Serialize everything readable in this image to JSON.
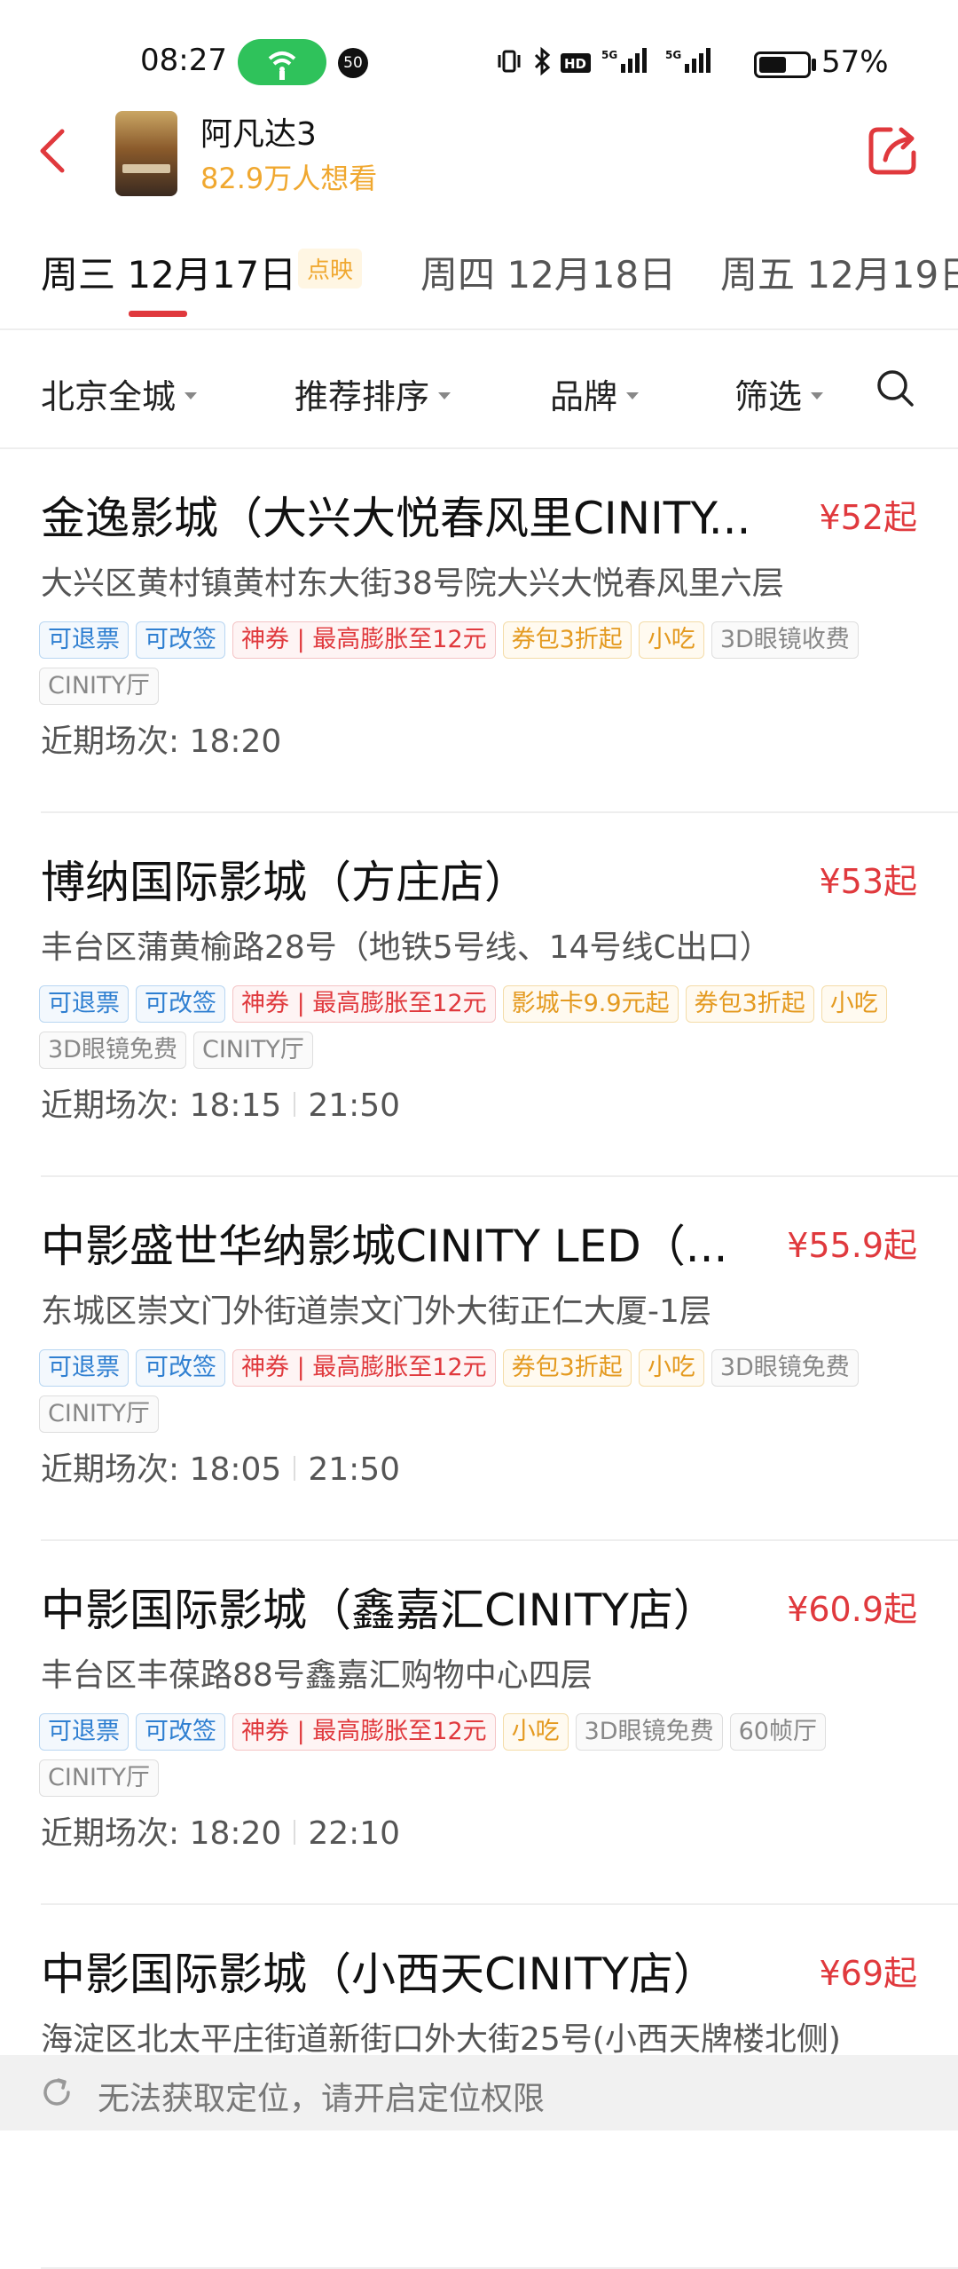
{
  "status_bar": {
    "time": "08:27",
    "notification_count": "50",
    "battery_percent": "57%",
    "battery_level": 0.57
  },
  "header": {
    "movie_title": "阿凡达3",
    "want_to_watch": "82.9万人想看"
  },
  "date_tabs": [
    {
      "label": "周三 12月17日",
      "tag": "点映",
      "active": true
    },
    {
      "label": "周四 12月18日",
      "active": false
    },
    {
      "label": "周五 12月19日",
      "active": false
    }
  ],
  "filters": {
    "city": "北京全城",
    "sort": "推荐排序",
    "brand": "品牌",
    "filter": "筛选"
  },
  "cinemas": [
    {
      "name": "金逸影城（大兴大悦春风里CINITY...",
      "price": "¥52起",
      "address": "大兴区黄村镇黄村东大街38号院大兴大悦春风里六层",
      "tags": [
        {
          "text": "可退票",
          "color": "blue"
        },
        {
          "text": "可改签",
          "color": "blue"
        },
        {
          "text": "神券 | 最高膨胀至12元",
          "color": "red"
        },
        {
          "text": "券包3折起",
          "color": "orange"
        },
        {
          "text": "小吃",
          "color": "orange"
        },
        {
          "text": "3D眼镜收费",
          "color": "gray"
        },
        {
          "text": "CINITY厅",
          "color": "gray"
        }
      ],
      "sessions_label": "近期场次:",
      "sessions": [
        "18:20"
      ]
    },
    {
      "name": "博纳国际影城（方庄店）",
      "price": "¥53起",
      "address": "丰台区蒲黄榆路28号（地铁5号线、14号线C出口）",
      "tags": [
        {
          "text": "可退票",
          "color": "blue"
        },
        {
          "text": "可改签",
          "color": "blue"
        },
        {
          "text": "神券 | 最高膨胀至12元",
          "color": "red"
        },
        {
          "text": "影城卡9.9元起",
          "color": "orange"
        },
        {
          "text": "券包3折起",
          "color": "orange"
        },
        {
          "text": "小吃",
          "color": "orange"
        },
        {
          "text": "3D眼镜免费",
          "color": "gray"
        },
        {
          "text": "CINITY厅",
          "color": "gray"
        }
      ],
      "sessions_label": "近期场次:",
      "sessions": [
        "18:15",
        "21:50"
      ]
    },
    {
      "name": "中影盛世华纳影城CINITY LED（...",
      "price": "¥55.9起",
      "address": "东城区崇文门外街道崇文门外大街正仁大厦-1层",
      "tags": [
        {
          "text": "可退票",
          "color": "blue"
        },
        {
          "text": "可改签",
          "color": "blue"
        },
        {
          "text": "神券 | 最高膨胀至12元",
          "color": "red"
        },
        {
          "text": "券包3折起",
          "color": "orange"
        },
        {
          "text": "小吃",
          "color": "orange"
        },
        {
          "text": "3D眼镜免费",
          "color": "gray"
        },
        {
          "text": "CINITY厅",
          "color": "gray"
        }
      ],
      "sessions_label": "近期场次:",
      "sessions": [
        "18:05",
        "21:50"
      ]
    },
    {
      "name": "中影国际影城（鑫嘉汇CINITY店）",
      "price": "¥60.9起",
      "address": "丰台区丰葆路88号鑫嘉汇购物中心四层",
      "tags": [
        {
          "text": "可退票",
          "color": "blue"
        },
        {
          "text": "可改签",
          "color": "blue"
        },
        {
          "text": "神券 | 最高膨胀至12元",
          "color": "red"
        },
        {
          "text": "小吃",
          "color": "orange"
        },
        {
          "text": "3D眼镜免费",
          "color": "gray"
        },
        {
          "text": "60帧厅",
          "color": "gray"
        },
        {
          "text": "CINITY厅",
          "color": "gray"
        }
      ],
      "sessions_label": "近期场次:",
      "sessions": [
        "18:20",
        "22:10"
      ]
    },
    {
      "name": "中影国际影城（小西天CINITY店）",
      "price": "¥69起",
      "address": "海淀区北太平庄街道新街口外大街25号(小西天牌楼北侧)",
      "tags": [],
      "sessions_label": "",
      "sessions": []
    }
  ],
  "toast": {
    "text": "无法获取定位，请开启定位权限"
  },
  "colors": {
    "accent_red": "#e0393d",
    "want_orange": "#f0a830",
    "tag_blue": "#2f7fd1"
  }
}
